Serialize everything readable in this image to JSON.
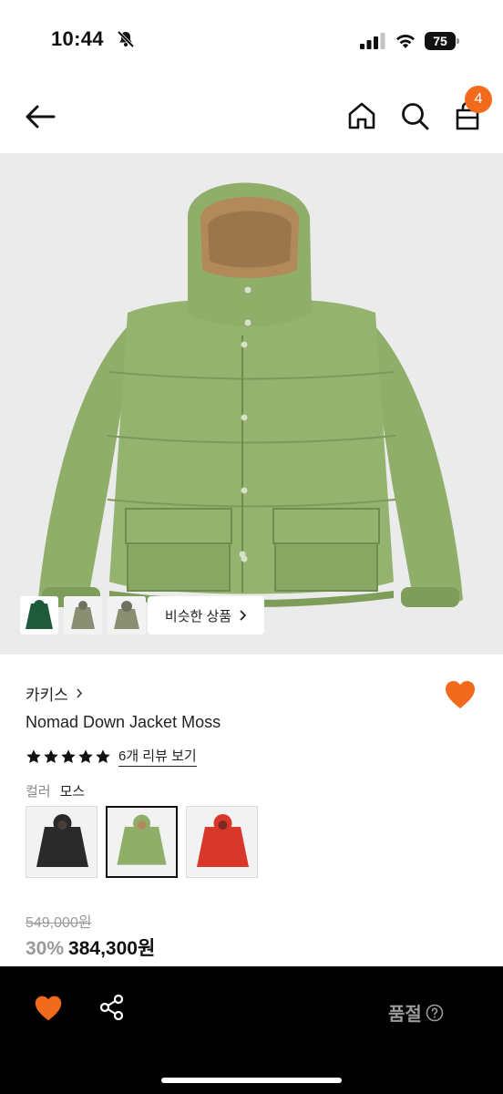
{
  "status_bar": {
    "time": "10:44",
    "battery": "75"
  },
  "header": {
    "cart_count": "4"
  },
  "gallery": {
    "similar_label": "비슷한 상품"
  },
  "product": {
    "brand": "카키스",
    "name": "Nomad Down Jacket Moss",
    "rating_stars": 5,
    "review_link": "6개 리뷰 보기",
    "color_label": "컬러",
    "color_value": "모스",
    "swatches": [
      {
        "color": "#2a2a2a",
        "selected": false
      },
      {
        "color": "#8fae6a",
        "selected": true
      },
      {
        "color": "#d8372a",
        "selected": false
      }
    ],
    "original_price": "549,000원",
    "discount": "30%",
    "sale_price": "384,300원"
  },
  "bottom_bar": {
    "status": "품절"
  },
  "colors": {
    "accent": "#f26a1b",
    "jacket": "#8fae6a",
    "jacket_dark": "#6d8c4f",
    "hood_lining": "#b28a5a"
  }
}
